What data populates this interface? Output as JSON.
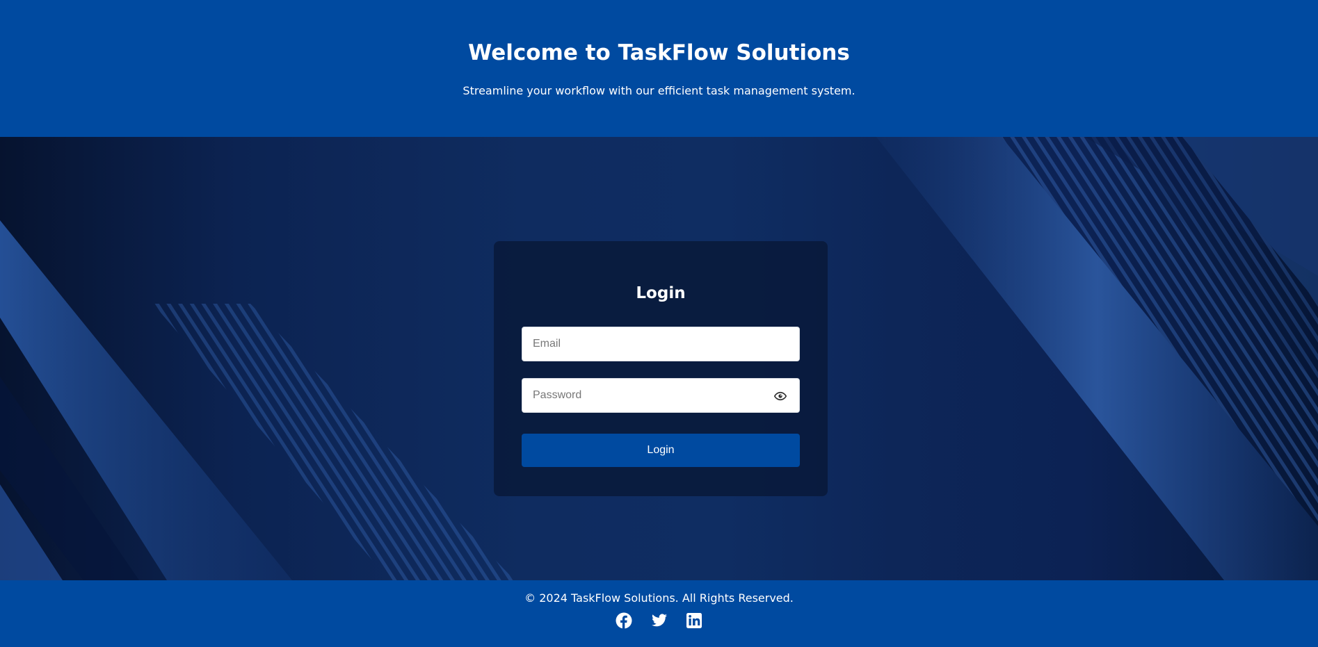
{
  "header": {
    "title": "Welcome to TaskFlow Solutions",
    "subtitle": "Streamline your workflow with our efficient task management system."
  },
  "login": {
    "title": "Login",
    "email_placeholder": "Email",
    "password_placeholder": "Password",
    "button_label": "Login",
    "show_password_icon": "eye-icon"
  },
  "footer": {
    "copyright": "© 2024 TaskFlow Solutions. All Rights Reserved.",
    "social": [
      "facebook-icon",
      "twitter-icon",
      "linkedin-icon"
    ]
  },
  "colors": {
    "brand_blue": "#004aa0",
    "hero_dark": "#0b1f48",
    "card_bg": "#091838",
    "text_white": "#ffffff"
  }
}
